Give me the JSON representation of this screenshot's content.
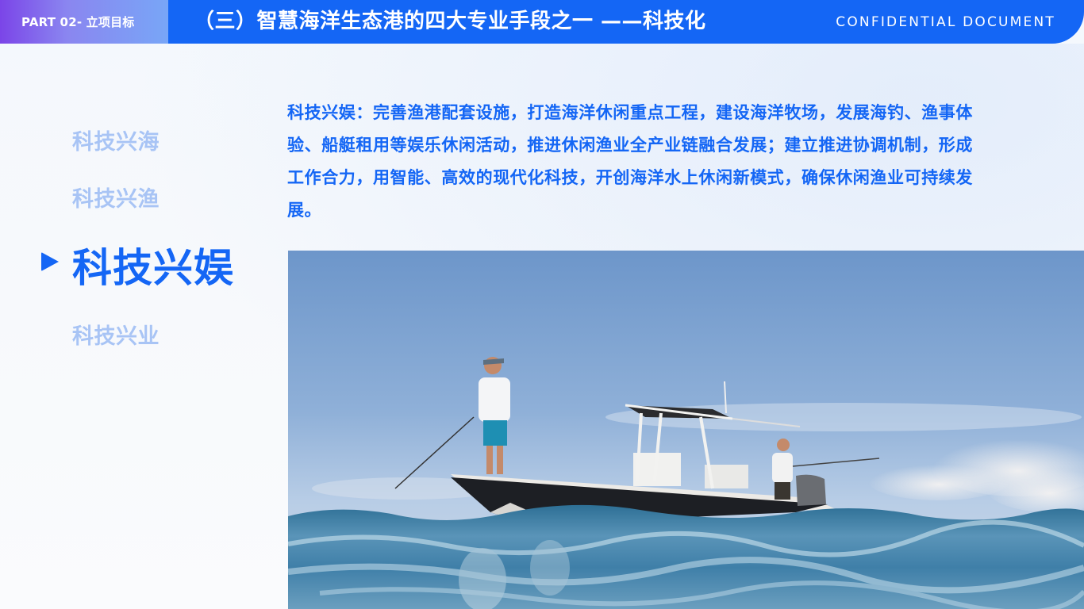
{
  "header": {
    "part_label": "PART 02- 立项目标",
    "title": "（三）智慧海洋生态港的四大专业手段之一 ——科技化",
    "confidential": "CONFIDENTIAL DOCUMENT"
  },
  "nav": {
    "items": [
      {
        "label": "科技兴海",
        "active": false
      },
      {
        "label": "科技兴渔",
        "active": false
      },
      {
        "label": "科技兴娱",
        "active": true
      },
      {
        "label": "科技兴业",
        "active": false
      }
    ],
    "active_icon": "play-triangle-icon"
  },
  "content": {
    "description": "科技兴娱：完善渔港配套设施，打造海洋休闲重点工程，建设海洋牧场，发展海钓、渔事体验、船艇租用等娱乐休闲活动，推进休闲渔业全产业链融合发展；建立推进协调机制，形成工作合力，用智能、高效的现代化科技，开创海洋水上休闲新模式，确保休闲渔业可持续发展。",
    "photo_alt": "两名钓鱼者站在海上的中控艇上垂钓，前景为海浪"
  },
  "colors": {
    "primary": "#1466f5",
    "nav_inactive": "#a8c4f5",
    "part_gradient_start": "#7b45e8",
    "part_gradient_end": "#78a6f7"
  }
}
